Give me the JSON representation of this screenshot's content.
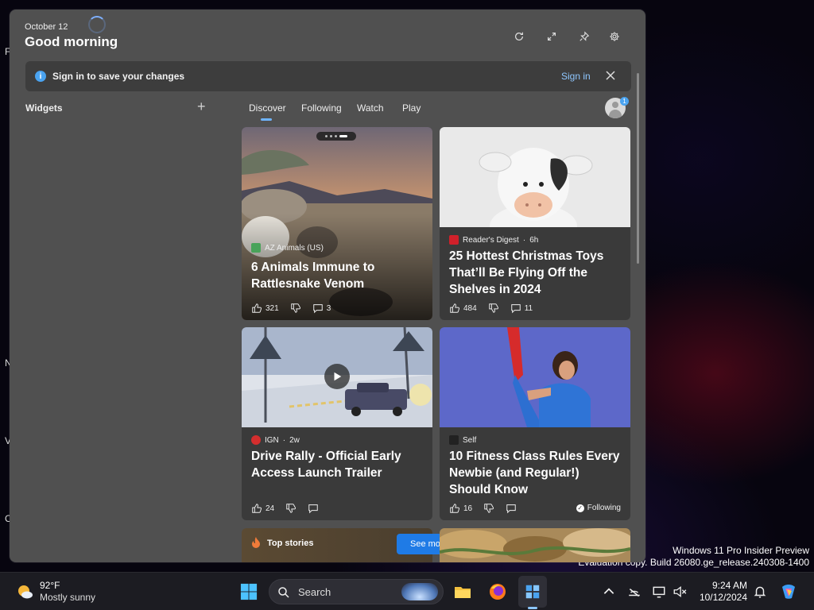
{
  "desktop": {
    "letters": [
      "F",
      "N",
      "V",
      "C"
    ],
    "watermark_line1": "Windows 11 Pro Insider Preview",
    "watermark_line2": "Evaluation copy. Build 26080.ge_release.240308-1400"
  },
  "header": {
    "date": "October 12",
    "greeting": "Good morning",
    "buttons": [
      "refresh-icon",
      "expand-icon",
      "pin-icon",
      "gear-icon"
    ]
  },
  "banner": {
    "message": "Sign in to save your changes",
    "signin": "Sign in"
  },
  "widgets": {
    "label": "Widgets",
    "add": "+"
  },
  "tabs": [
    {
      "label": "Discover",
      "active": true
    },
    {
      "label": "Following"
    },
    {
      "label": "Watch"
    },
    {
      "label": "Play"
    }
  ],
  "profile": {
    "badge": "1"
  },
  "cards": [
    {
      "source": "AZ Animals (US)",
      "time": "",
      "title": "6 Animals Immune to Rattlesnake Venom",
      "likes": "321",
      "comments": "3"
    },
    {
      "source": "Reader's Digest",
      "time": "6h",
      "title": "25 Hottest Christmas Toys That’ll Be Flying Off the Shelves in 2024",
      "likes": "484",
      "comments": "11"
    },
    {
      "source": "IGN",
      "time": "2w",
      "title": "Drive Rally - Official Early Access Launch Trailer",
      "likes": "24",
      "comments": ""
    },
    {
      "source": "Self",
      "time": "",
      "title": "10 Fitness Class Rules Every Newbie (and Regular!) Should Know",
      "likes": "16",
      "comments": "",
      "following": "Following"
    }
  ],
  "top_stories": {
    "label": "Top stories",
    "see_more": "See more"
  },
  "taskbar": {
    "temp": "92°F",
    "condition": "Mostly sunny",
    "search_placeholder": "Search",
    "time": "9:24 AM",
    "date": "10/12/2024"
  },
  "colors": {
    "panel": "#505050",
    "card": "#3a3a3a",
    "accent": "#1f7be6",
    "link": "#8fc7ff"
  }
}
